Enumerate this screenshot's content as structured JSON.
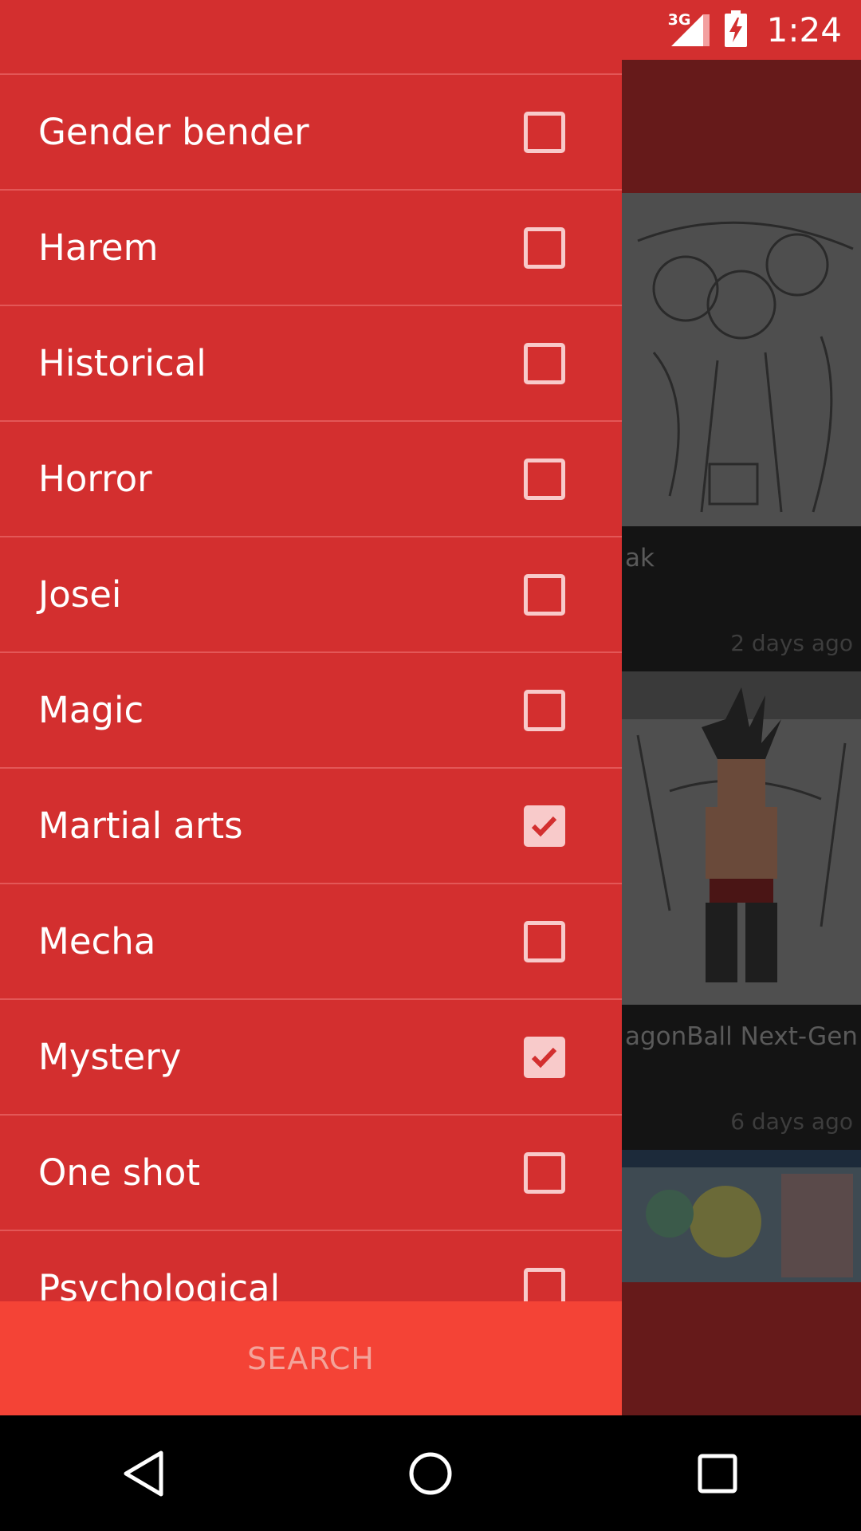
{
  "status_bar": {
    "network": "3G",
    "time": "1:24",
    "icons": [
      "signal-icon",
      "battery-charging-icon"
    ]
  },
  "background_feed": {
    "cards": [
      {
        "title": "ak",
        "time": "2 days ago"
      },
      {
        "title": "agonBall Next-Gen",
        "time": "6 days ago"
      },
      {
        "title": "",
        "time": ""
      }
    ]
  },
  "drawer": {
    "genres": [
      {
        "label": "Gender bender",
        "checked": false
      },
      {
        "label": "Harem",
        "checked": false
      },
      {
        "label": "Historical",
        "checked": false
      },
      {
        "label": "Horror",
        "checked": false
      },
      {
        "label": "Josei",
        "checked": false
      },
      {
        "label": "Magic",
        "checked": false
      },
      {
        "label": "Martial arts",
        "checked": true
      },
      {
        "label": "Mecha",
        "checked": false
      },
      {
        "label": "Mystery",
        "checked": true
      },
      {
        "label": "One shot",
        "checked": false
      },
      {
        "label": "Psychological",
        "checked": false
      }
    ],
    "search_label": "SEARCH"
  },
  "colors": {
    "primary": "#d32f2f",
    "accent": "#f44336",
    "checkbox": "#f8caca"
  },
  "nav_bar": {
    "buttons": [
      "back-icon",
      "home-icon",
      "recents-icon"
    ]
  }
}
